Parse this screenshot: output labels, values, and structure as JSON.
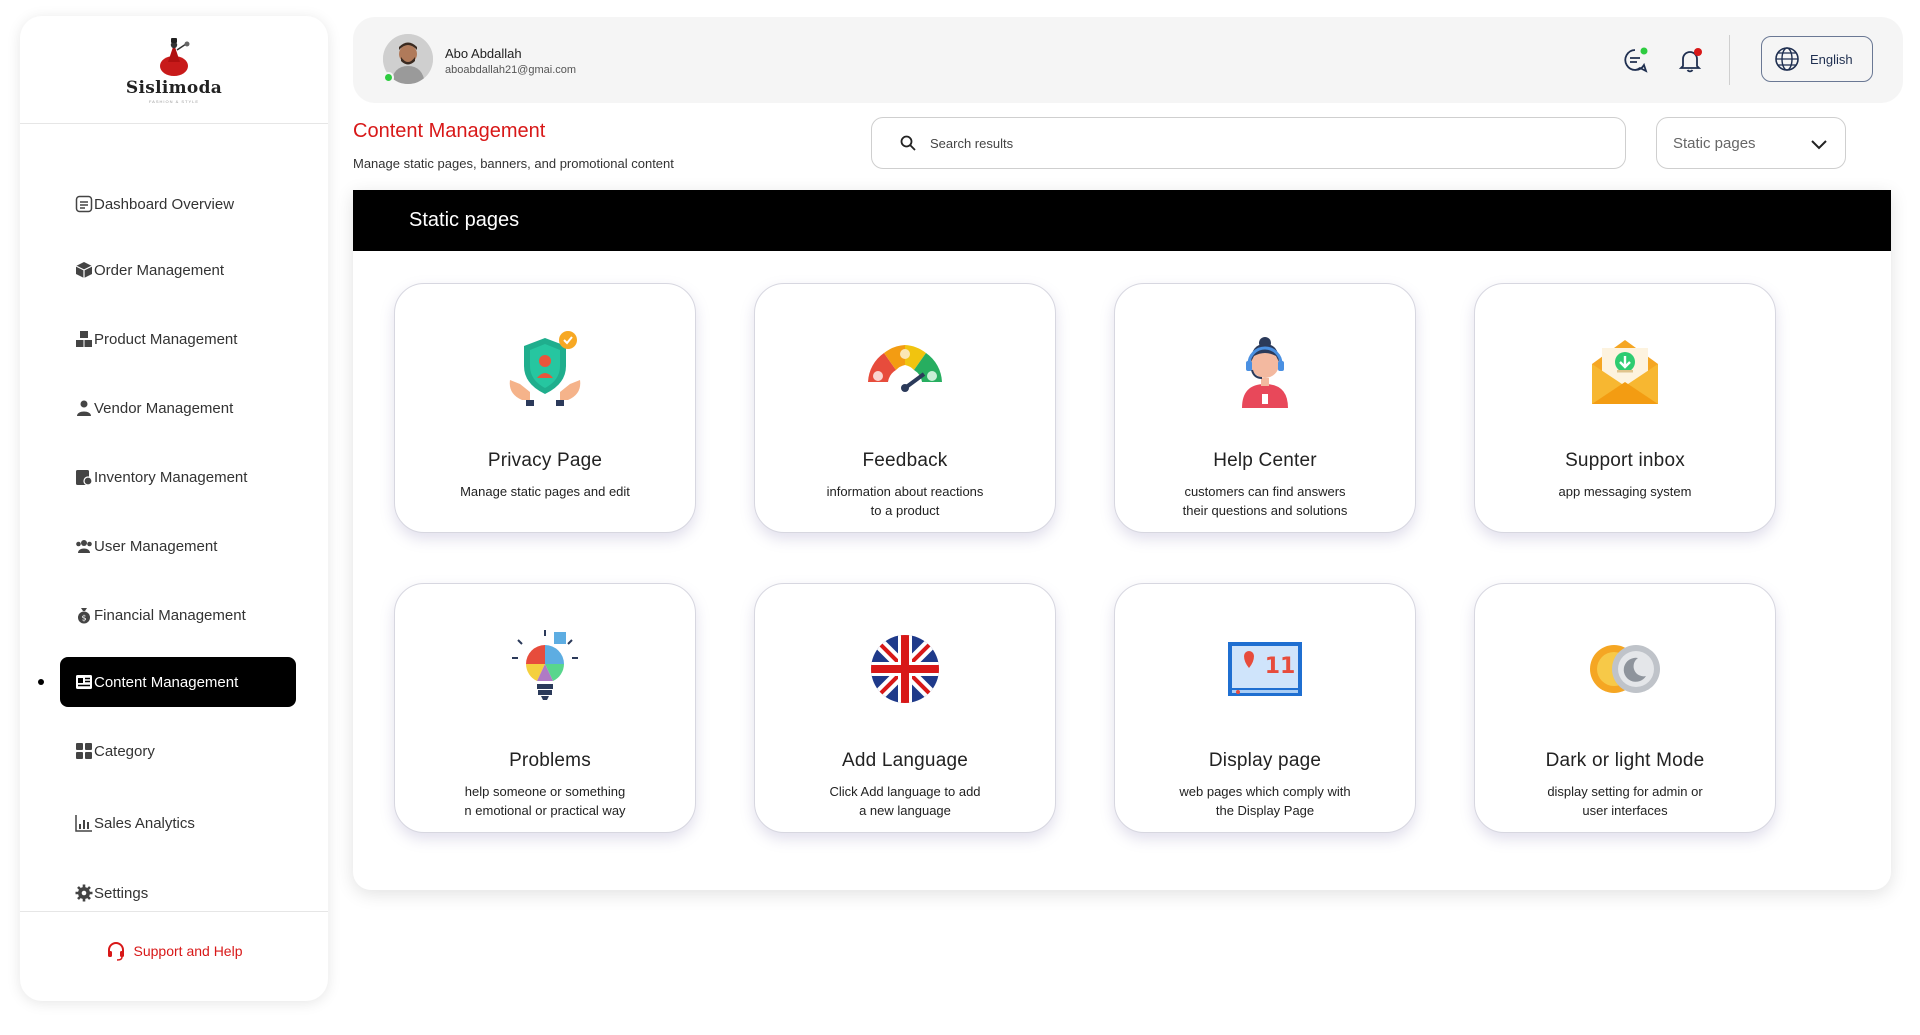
{
  "brand": {
    "name": "Sislimoda",
    "tagline": "FASHION & STYLE"
  },
  "sidebar": {
    "items": [
      {
        "label": "Dashboard Overview",
        "icon": "dashboard-icon"
      },
      {
        "label": "Order Management",
        "icon": "box-icon"
      },
      {
        "label": "Product Management",
        "icon": "boxes-icon"
      },
      {
        "label": "Vendor Management",
        "icon": "vendor-icon"
      },
      {
        "label": "Inventory Management",
        "icon": "inventory-icon"
      },
      {
        "label": "User Management",
        "icon": "users-icon"
      },
      {
        "label": "Financial Management",
        "icon": "money-bag-icon"
      },
      {
        "label": "Content Management",
        "icon": "content-icon",
        "active": true
      },
      {
        "label": "Category",
        "icon": "grid-icon"
      },
      {
        "label": "Sales Analytics",
        "icon": "chart-icon"
      },
      {
        "label": "Settings",
        "icon": "gear-icon"
      }
    ],
    "support_label": "Support and Help"
  },
  "header": {
    "user_name": "Abo Abdallah",
    "user_email": "aboabdallah21@gmai.com",
    "language": "English"
  },
  "page": {
    "title": "Content Management",
    "subtitle": "Manage static pages, banners, and promotional content"
  },
  "search": {
    "placeholder": "Search results"
  },
  "filter": {
    "selected": "Static pages"
  },
  "panel": {
    "title": "Static pages",
    "cards": [
      {
        "title": "Privacy Page",
        "desc": "Manage static pages and edit",
        "icon": "privacy-shield-icon"
      },
      {
        "title": "Feedback",
        "desc": "information about reactions\nto a product",
        "icon": "feedback-gauge-icon"
      },
      {
        "title": "Help Center",
        "desc": "customers can find answers\ntheir questions and solutions",
        "icon": "help-center-agent-icon"
      },
      {
        "title": "Support inbox",
        "desc": "app messaging system",
        "icon": "support-inbox-icon"
      },
      {
        "title": "Problems",
        "desc": "help someone or something\nn emotional or practical way",
        "icon": "problems-bulb-icon"
      },
      {
        "title": "Add Language",
        "desc": "Click Add language to add\na new language",
        "icon": "uk-flag-icon"
      },
      {
        "title": "Display page",
        "desc": "web pages which comply with\nthe Display Page",
        "icon": "display-page-icon"
      },
      {
        "title": "Dark or light Mode",
        "desc": "display setting for admin or\nuser interfaces",
        "icon": "sun-moon-icon"
      }
    ]
  },
  "colors": {
    "accent": "#d81818",
    "active_bg": "#000000",
    "online": "#2ecc40"
  }
}
